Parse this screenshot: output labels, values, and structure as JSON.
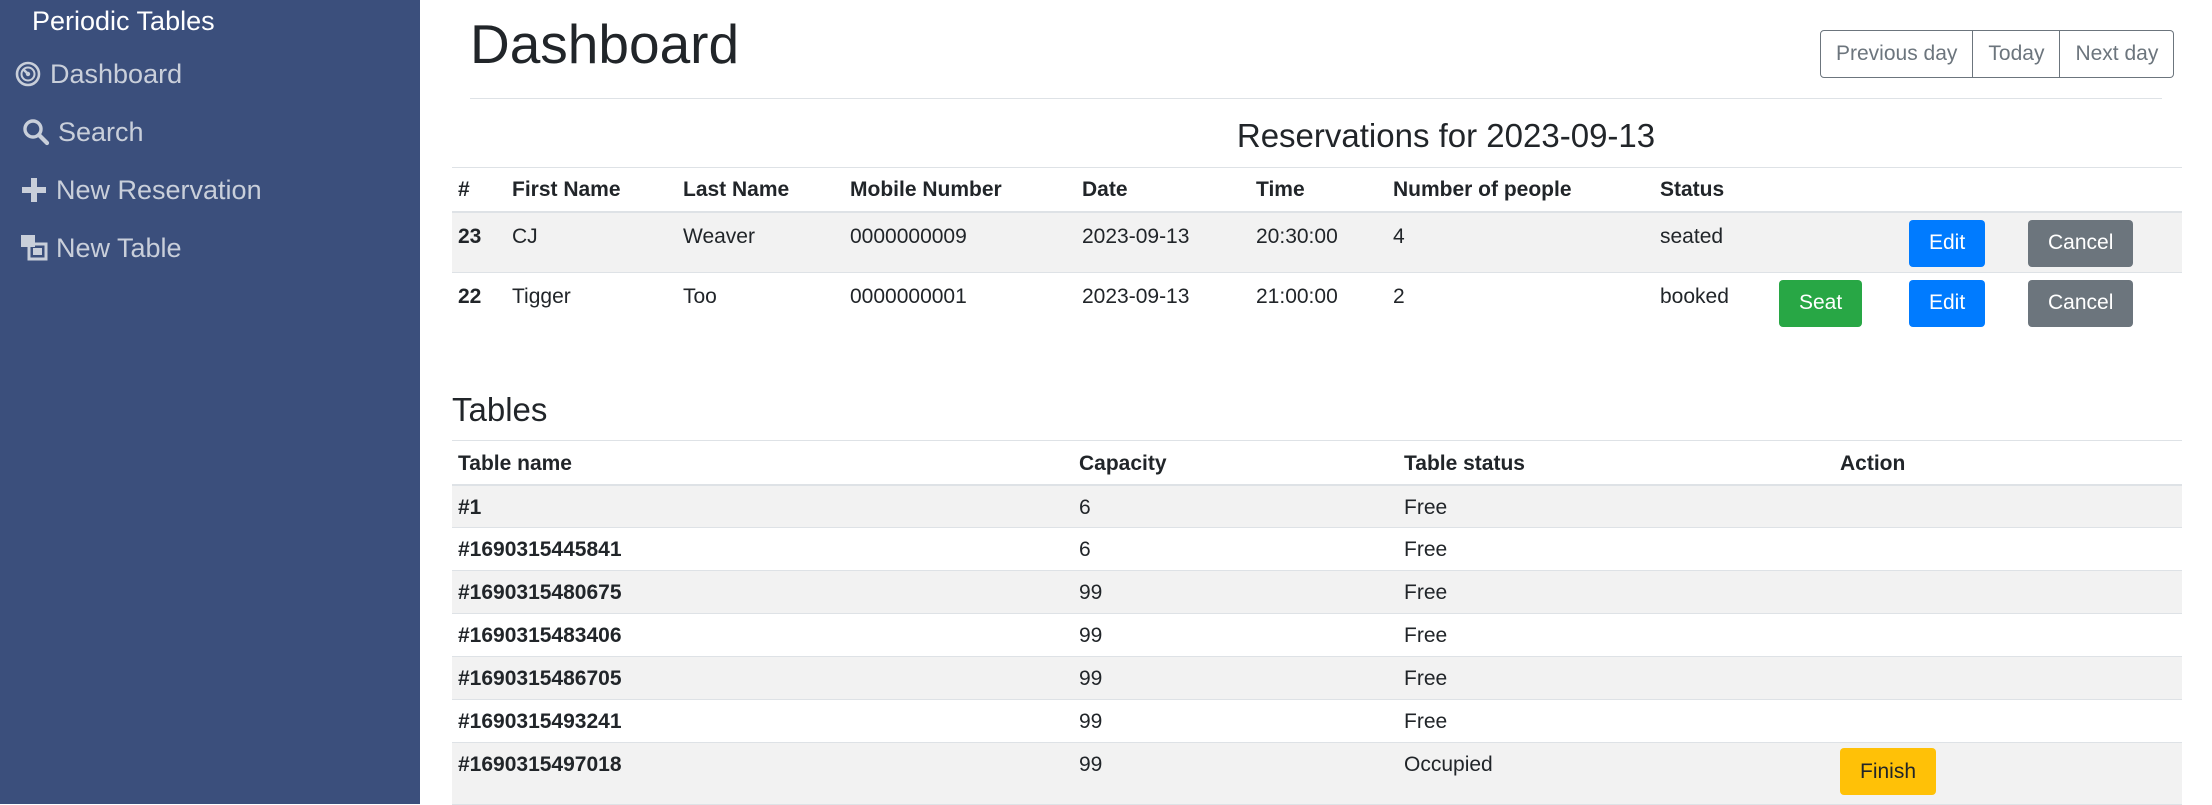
{
  "sidebar": {
    "brand": "Periodic Tables",
    "items": [
      {
        "label": "Dashboard",
        "icon": "dashboard-icon"
      },
      {
        "label": "Search",
        "icon": "search-icon"
      },
      {
        "label": "New Reservation",
        "icon": "plus-icon"
      },
      {
        "label": "New Table",
        "icon": "table-icon"
      }
    ]
  },
  "header": {
    "title": "Dashboard",
    "buttons": {
      "previous": "Previous day",
      "today": "Today",
      "next": "Next day"
    }
  },
  "reservations": {
    "title": "Reservations for 2023-09-13",
    "columns": [
      "#",
      "First Name",
      "Last Name",
      "Mobile Number",
      "Date",
      "Time",
      "Number of people",
      "Status"
    ],
    "rows": [
      {
        "id": "23",
        "first_name": "CJ",
        "last_name": "Weaver",
        "mobile": "0000000009",
        "date": "2023-09-13",
        "time": "20:30:00",
        "people": "4",
        "status": "seated",
        "edit": "Edit",
        "cancel": "Cancel"
      },
      {
        "id": "22",
        "first_name": "Tigger",
        "last_name": "Too",
        "mobile": "0000000001",
        "date": "2023-09-13",
        "time": "21:00:00",
        "people": "2",
        "status": "booked",
        "seat": "Seat",
        "edit": "Edit",
        "cancel": "Cancel"
      }
    ]
  },
  "tables": {
    "title": "Tables",
    "columns": [
      "Table name",
      "Capacity",
      "Table status",
      "Action"
    ],
    "rows": [
      {
        "name": "#1",
        "capacity": "6",
        "status": "Free"
      },
      {
        "name": "#1690315445841",
        "capacity": "6",
        "status": "Free"
      },
      {
        "name": "#1690315480675",
        "capacity": "99",
        "status": "Free"
      },
      {
        "name": "#1690315483406",
        "capacity": "99",
        "status": "Free"
      },
      {
        "name": "#1690315486705",
        "capacity": "99",
        "status": "Free"
      },
      {
        "name": "#1690315493241",
        "capacity": "99",
        "status": "Free"
      },
      {
        "name": "#1690315497018",
        "capacity": "99",
        "status": "Occupied",
        "action": "Finish"
      }
    ]
  },
  "colors": {
    "sidebar": "#3b4f7c",
    "seat": "#28a745",
    "edit": "#007bff",
    "cancel": "#6c757d",
    "finish": "#ffc107"
  }
}
